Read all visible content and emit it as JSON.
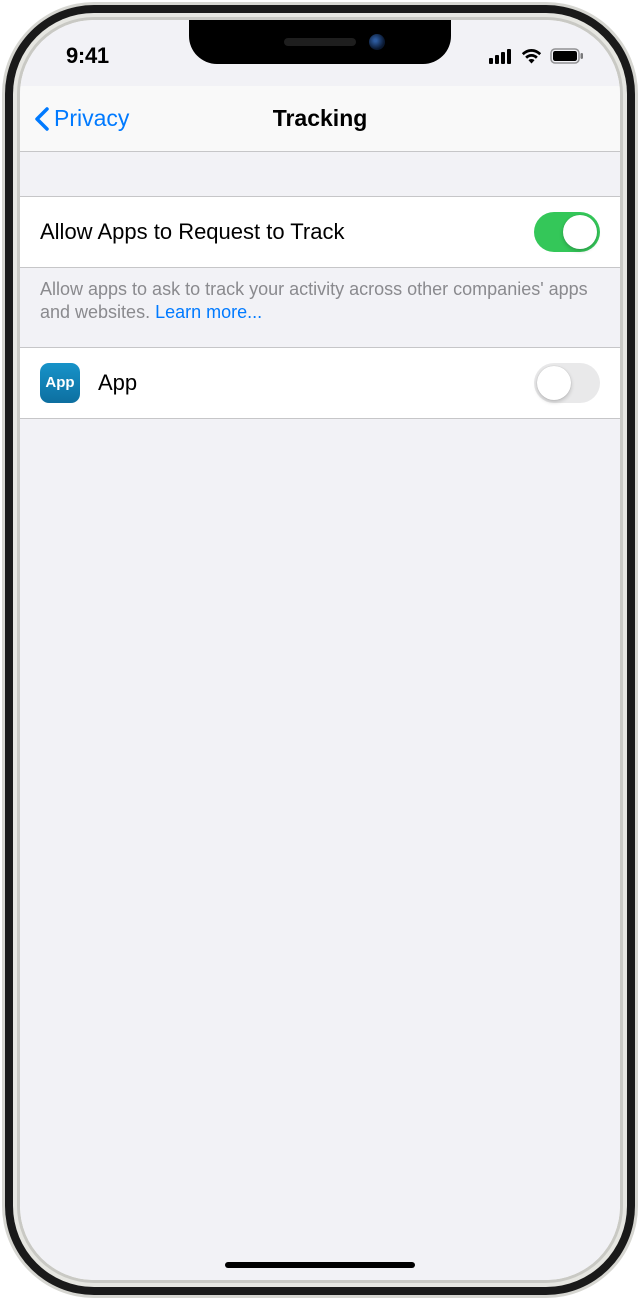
{
  "status": {
    "time": "9:41"
  },
  "nav": {
    "back": "Privacy",
    "title": "Tracking"
  },
  "allow": {
    "label": "Allow Apps to Request to Track",
    "footer": "Allow apps to ask to track your activity across other companies' apps and websites. ",
    "learn_more": "Learn more...",
    "enabled": true
  },
  "apps": [
    {
      "name": "App",
      "icon_label": "App",
      "enabled": false
    }
  ]
}
